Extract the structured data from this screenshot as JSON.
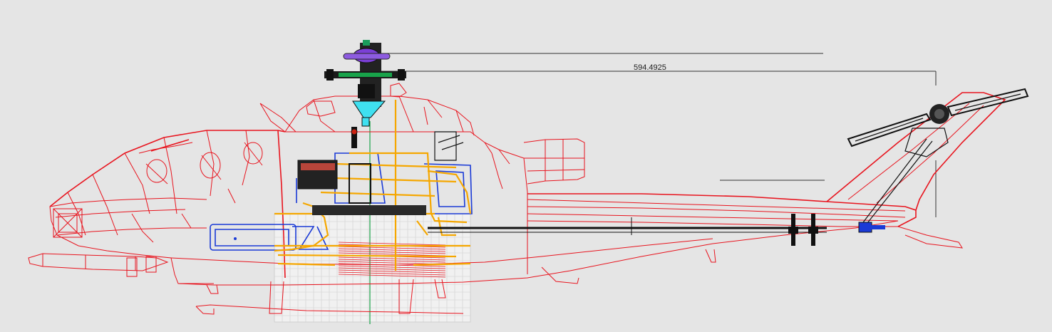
{
  "drawing": {
    "dimension_label": "594.4925",
    "colors": {
      "background": "#e5e5e5",
      "fuselage_wireframe": "#e8141e",
      "mechanics": "#111111",
      "frame_blue": "#1a3ad6",
      "frame_orange": "#f5a700",
      "rotor_hub_purple": "#7b3fd6",
      "swashplate_cyan": "#3fe0f0",
      "shaft_green": "#18a34a"
    }
  }
}
